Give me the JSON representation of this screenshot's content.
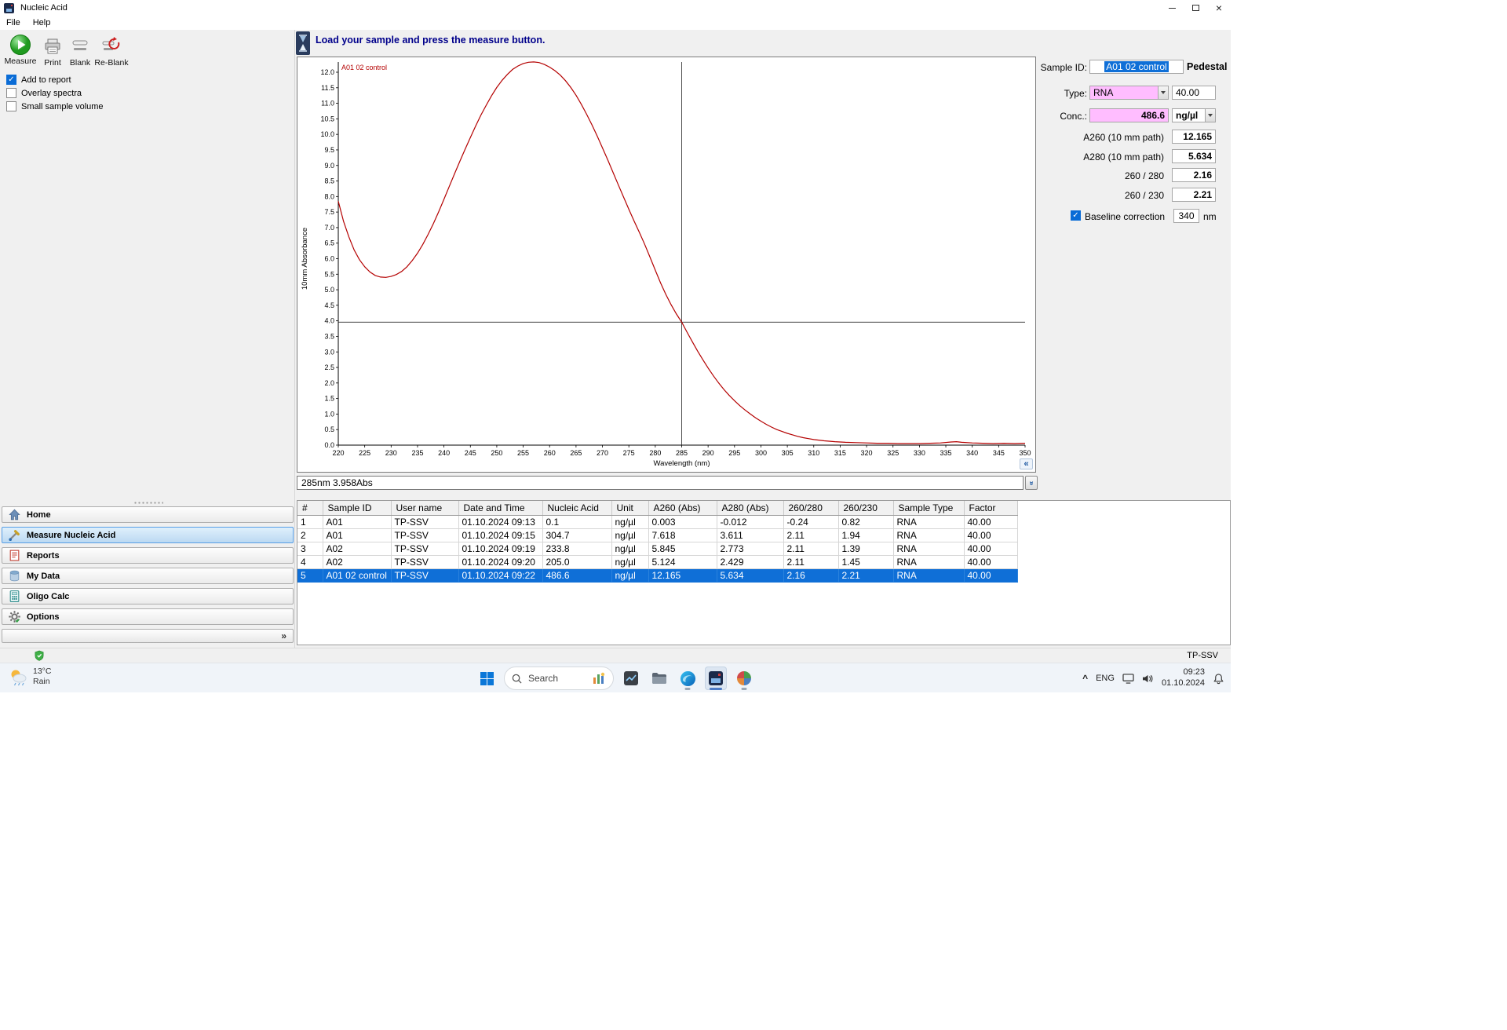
{
  "window": {
    "title": "Nucleic Acid"
  },
  "menu": {
    "items": [
      "File",
      "Help"
    ]
  },
  "toolbar": {
    "measure": "Measure",
    "print": "Print",
    "blank": "Blank",
    "reblank": "Re-Blank"
  },
  "checkboxes": [
    {
      "label": "Add to report",
      "checked": true
    },
    {
      "label": "Overlay spectra",
      "checked": false
    },
    {
      "label": "Small sample volume",
      "checked": false
    }
  ],
  "sidebar": {
    "items": [
      {
        "label": "Home",
        "selected": false
      },
      {
        "label": "Measure Nucleic Acid",
        "selected": true
      },
      {
        "label": "Reports",
        "selected": false
      },
      {
        "label": "My Data",
        "selected": false
      },
      {
        "label": "Oligo Calc",
        "selected": false
      },
      {
        "label": "Options",
        "selected": false
      }
    ]
  },
  "message_bar": {
    "text": "Load your sample and press the measure button."
  },
  "chart_data": {
    "type": "line",
    "xlabel": "Wavelength (nm)",
    "ylabel": "10mm Absorbance",
    "xlim": [
      220,
      350
    ],
    "ylim": [
      0,
      12.5
    ],
    "grid": false,
    "legend": "inline-top-left",
    "x_ticks": [
      220,
      225,
      230,
      235,
      240,
      245,
      250,
      255,
      260,
      265,
      270,
      275,
      280,
      285,
      290,
      295,
      300,
      305,
      310,
      315,
      320,
      325,
      330,
      335,
      340,
      345,
      350
    ],
    "y_ticks": [
      0,
      0.5,
      1,
      1.5,
      2,
      2.5,
      3,
      3.5,
      4,
      4.5,
      5,
      5.5,
      6,
      6.5,
      7,
      7.5,
      8,
      8.5,
      9,
      9.5,
      10,
      10.5,
      11,
      11.5,
      12
    ],
    "crosshair": {
      "x": 285,
      "y": 3.958
    },
    "series": [
      {
        "name": "A01 02 control",
        "color": "#b40000",
        "points": [
          [
            220,
            7.85
          ],
          [
            221,
            7.2
          ],
          [
            222,
            6.7
          ],
          [
            223,
            6.28
          ],
          [
            224,
            5.97
          ],
          [
            225,
            5.74
          ],
          [
            226,
            5.57
          ],
          [
            227,
            5.46
          ],
          [
            228,
            5.41
          ],
          [
            229,
            5.4
          ],
          [
            230,
            5.43
          ],
          [
            231,
            5.49
          ],
          [
            232,
            5.59
          ],
          [
            233,
            5.74
          ],
          [
            234,
            5.94
          ],
          [
            235,
            6.18
          ],
          [
            236,
            6.46
          ],
          [
            237,
            6.78
          ],
          [
            238,
            7.13
          ],
          [
            239,
            7.51
          ],
          [
            240,
            7.91
          ],
          [
            241,
            8.32
          ],
          [
            242,
            8.73
          ],
          [
            243,
            9.13
          ],
          [
            244,
            9.52
          ],
          [
            245,
            9.9
          ],
          [
            246,
            10.27
          ],
          [
            247,
            10.62
          ],
          [
            248,
            10.94
          ],
          [
            249,
            11.24
          ],
          [
            250,
            11.51
          ],
          [
            251,
            11.74
          ],
          [
            252,
            11.93
          ],
          [
            253,
            12.09
          ],
          [
            254,
            12.2
          ],
          [
            255,
            12.28
          ],
          [
            256,
            12.32
          ],
          [
            257,
            12.33
          ],
          [
            258,
            12.31
          ],
          [
            259,
            12.25
          ],
          [
            260,
            12.165
          ],
          [
            261,
            12.05
          ],
          [
            262,
            11.91
          ],
          [
            263,
            11.73
          ],
          [
            264,
            11.51
          ],
          [
            265,
            11.26
          ],
          [
            266,
            10.97
          ],
          [
            267,
            10.65
          ],
          [
            268,
            10.31
          ],
          [
            269,
            9.95
          ],
          [
            270,
            9.57
          ],
          [
            271,
            9.18
          ],
          [
            272,
            8.78
          ],
          [
            273,
            8.38
          ],
          [
            274,
            7.98
          ],
          [
            275,
            7.59
          ],
          [
            276,
            7.21
          ],
          [
            277,
            6.84
          ],
          [
            278,
            6.46
          ],
          [
            279,
            6.05
          ],
          [
            280,
            5.634
          ],
          [
            281,
            5.22
          ],
          [
            282,
            4.85
          ],
          [
            283,
            4.52
          ],
          [
            284,
            4.22
          ],
          [
            285,
            3.958
          ],
          [
            286,
            3.64
          ],
          [
            287,
            3.33
          ],
          [
            288,
            3.03
          ],
          [
            289,
            2.75
          ],
          [
            290,
            2.48
          ],
          [
            291,
            2.23
          ],
          [
            292,
            2.0
          ],
          [
            293,
            1.79
          ],
          [
            294,
            1.6
          ],
          [
            295,
            1.43
          ],
          [
            296,
            1.27
          ],
          [
            297,
            1.13
          ],
          [
            298,
            1.0
          ],
          [
            299,
            0.88
          ],
          [
            300,
            0.77
          ],
          [
            301,
            0.67
          ],
          [
            302,
            0.58
          ],
          [
            303,
            0.5
          ],
          [
            304,
            0.44
          ],
          [
            305,
            0.38
          ],
          [
            306,
            0.33
          ],
          [
            307,
            0.28
          ],
          [
            308,
            0.24
          ],
          [
            309,
            0.21
          ],
          [
            310,
            0.18
          ],
          [
            312,
            0.14
          ],
          [
            314,
            0.11
          ],
          [
            316,
            0.09
          ],
          [
            318,
            0.08
          ],
          [
            320,
            0.07
          ],
          [
            322,
            0.06
          ],
          [
            324,
            0.06
          ],
          [
            326,
            0.05
          ],
          [
            328,
            0.05
          ],
          [
            330,
            0.05
          ],
          [
            332,
            0.06
          ],
          [
            334,
            0.07
          ],
          [
            336,
            0.1
          ],
          [
            337,
            0.11
          ],
          [
            338,
            0.09
          ],
          [
            340,
            0.07
          ],
          [
            342,
            0.06
          ],
          [
            344,
            0.05
          ],
          [
            346,
            0.06
          ],
          [
            348,
            0.05
          ],
          [
            350,
            0.06
          ]
        ]
      }
    ]
  },
  "readout": {
    "text": "285nm 3.958Abs"
  },
  "right_panel": {
    "sample_id_label": "Sample ID:",
    "sample_id_value": "A01 02 control",
    "pedestal_label": "Pedestal",
    "type_label": "Type:",
    "type_value": "RNA",
    "factor_value": "40.00",
    "conc_label": "Conc.:",
    "conc_value": "486.6",
    "unit_value": "ng/µl",
    "rows": [
      {
        "label": "A260 (10 mm path)",
        "value": "12.165"
      },
      {
        "label": "A280 (10 mm path)",
        "value": "5.634"
      },
      {
        "label": "260 / 280",
        "value": "2.16"
      },
      {
        "label": "260 / 230",
        "value": "2.21"
      }
    ],
    "baseline_label": "Baseline correction",
    "baseline_checked": true,
    "baseline_value": "340",
    "baseline_unit": "nm"
  },
  "table": {
    "columns": [
      "#",
      "Sample ID",
      "User name",
      "Date and Time",
      "Nucleic Acid",
      "Unit",
      "A260 (Abs)",
      "A280 (Abs)",
      "260/280",
      "260/230",
      "Sample Type",
      "Factor"
    ],
    "rows": [
      [
        "1",
        "A01",
        "TP-SSV",
        "01.10.2024 09:13",
        "0.1",
        "ng/µl",
        "0.003",
        "-0.012",
        "-0.24",
        "0.82",
        "RNA",
        "40.00"
      ],
      [
        "2",
        "A01",
        "TP-SSV",
        "01.10.2024 09:15",
        "304.7",
        "ng/µl",
        "7.618",
        "3.611",
        "2.11",
        "1.94",
        "RNA",
        "40.00"
      ],
      [
        "3",
        "A02",
        "TP-SSV",
        "01.10.2024 09:19",
        "233.8",
        "ng/µl",
        "5.845",
        "2.773",
        "2.11",
        "1.39",
        "RNA",
        "40.00"
      ],
      [
        "4",
        "A02",
        "TP-SSV",
        "01.10.2024 09:20",
        "205.0",
        "ng/µl",
        "5.124",
        "2.429",
        "2.11",
        "1.45",
        "RNA",
        "40.00"
      ],
      [
        "5",
        "A01 02 control",
        "TP-SSV",
        "01.10.2024 09:22",
        "486.6",
        "ng/µl",
        "12.165",
        "5.634",
        "2.16",
        "2.21",
        "RNA",
        "40.00"
      ]
    ],
    "selected_row": 4
  },
  "statusbar": {
    "user": "TP-SSV"
  },
  "taskbar": {
    "weather": {
      "temp": "13°C",
      "condition": "Rain"
    },
    "search_placeholder": "Search",
    "tray": {
      "language": "ENG",
      "time": "09:23",
      "date": "01.10.2024"
    }
  },
  "icons": {
    "chart_collapse": "«",
    "readout_expand": "»",
    "sidebar_expand": "»"
  },
  "colors": {
    "accent": "#0f6fd7",
    "pink_field": "#ffbdff",
    "message_text": "#00008b",
    "curve": "#b40000",
    "selected_row": "#0f6fd7"
  }
}
